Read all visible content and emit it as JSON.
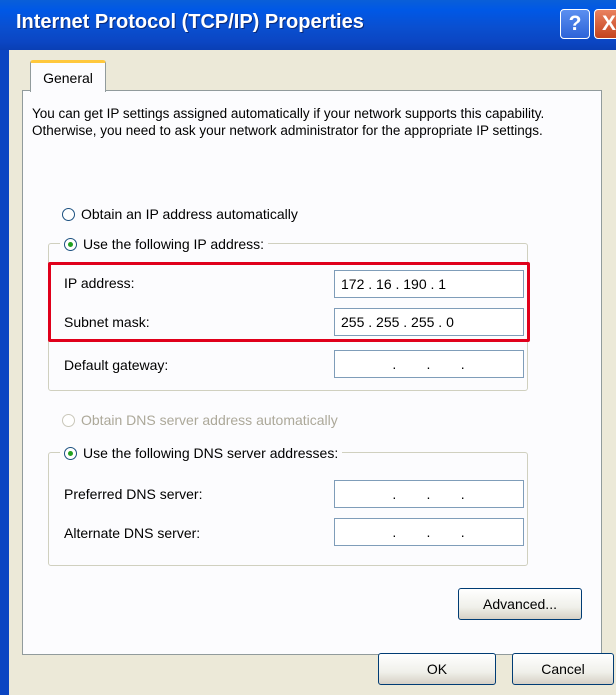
{
  "window": {
    "title": "Internet Protocol (TCP/IP) Properties",
    "help_button": "?",
    "close_button": "X"
  },
  "tabs": [
    {
      "label": "General",
      "selected": true
    }
  ],
  "intro_text": "You can get IP settings assigned automatically if your network supports this capability. Otherwise, you need to ask your network administrator for the appropriate IP settings.",
  "ip_mode": {
    "auto_label": "Obtain an IP address automatically",
    "manual_label": "Use the following IP address:",
    "selected": "manual"
  },
  "ip_fields": {
    "ip_address": {
      "label": "IP address:",
      "value": "172 . 16 . 190 . 1"
    },
    "subnet_mask": {
      "label": "Subnet mask:",
      "value": "255 . 255 . 255 . 0"
    },
    "default_gateway": {
      "label": "Default gateway:",
      "value": ".      .      ."
    }
  },
  "dns_mode": {
    "auto_label": "Obtain DNS server address automatically",
    "manual_label": "Use the following DNS server addresses:",
    "selected": "manual"
  },
  "dns_fields": {
    "preferred": {
      "label": "Preferred DNS server:",
      "value": ".      .      ."
    },
    "alternate": {
      "label": "Alternate DNS server:",
      "value": ".      .      ."
    }
  },
  "buttons": {
    "advanced": "Advanced...",
    "ok": "OK",
    "cancel": "Cancel"
  },
  "colors": {
    "title_bar": "#0b45c2",
    "highlight_box": "#e0001b",
    "radio_selected": "#21a121",
    "dialog_bg": "#ece9d8"
  }
}
